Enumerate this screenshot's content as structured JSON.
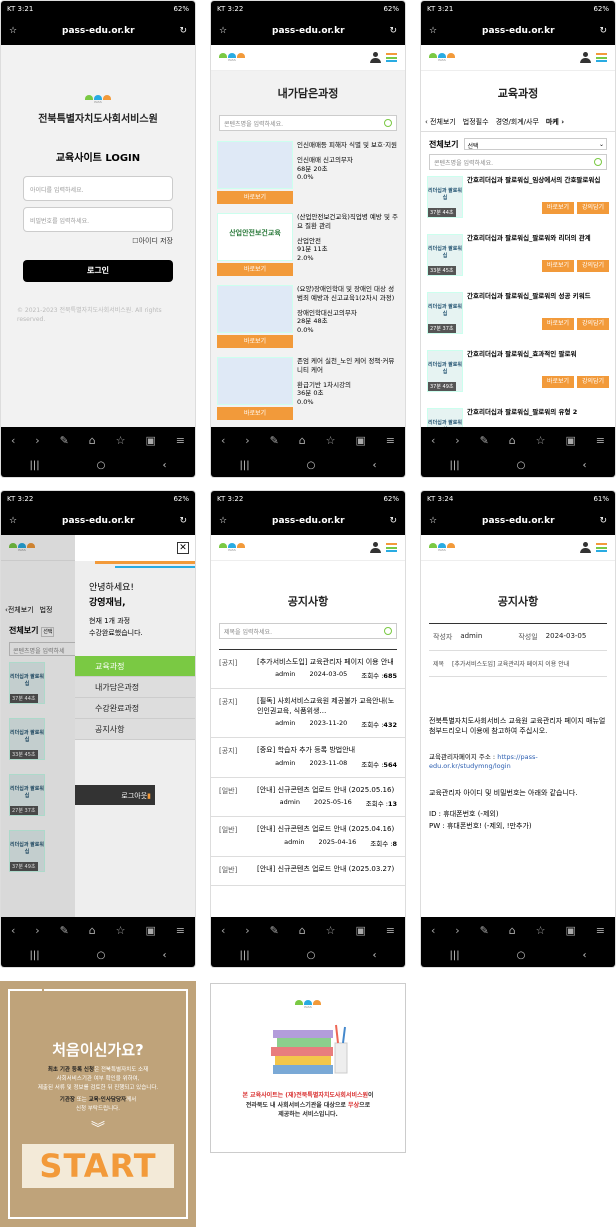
{
  "status": {
    "carrier1": "KT 3:21",
    "carrier2": "KT 3:22",
    "carrier3": "KT 3:21",
    "carrier4": "KT 3:22",
    "carrier5": "KT 3:22",
    "carrier6": "KT 3:24",
    "bat62": "62%",
    "bat61": "61%"
  },
  "url": "pass-edu.or.kr",
  "logo_small": "PASS",
  "login": {
    "org": "전북특별자치도사회서비스원",
    "title": "교육사이트 LOGIN",
    "id_ph": "아이디를 입력하세요.",
    "pw_ph": "비밀번호를 입력하세요.",
    "save": "아이디 저장",
    "button": "로그인",
    "copy": "© 2021-2023 전북특별자치도사회서비스원. All rights reserved."
  },
  "mycourses": {
    "title": "내가담은과정",
    "search_ph": "콘텐츠명을 입력하세요.",
    "items": [
      {
        "title": "인신매매등 피해자 식별 및 보호·지원",
        "sub": "인신매매 신고의무자",
        "meta": "68분 20초",
        "pct": "0.0%",
        "btn": "바로보기"
      },
      {
        "title": "(산업안전보건교육)직업병 예방 및 주요 질환 관리",
        "sub": "산업안전",
        "meta": "91분 11초",
        "pct": "2.0%",
        "btn": "바로보기",
        "thumb": "산업안전보건교육"
      },
      {
        "title": "(요양)장애인학대 및 장애인 대상 성범죄 예방과 신고교육1(2차시 과정)",
        "sub": "장애인학대신고의무자",
        "meta": "28분 48초",
        "pct": "0.0%",
        "btn": "바로보기"
      },
      {
        "title": "존엄 케어 실천_노인 케어 정책·커뮤니티 케어",
        "sub": "환급기반 1차시강의",
        "meta": "36분 0초",
        "pct": "0.0%",
        "btn": "바로보기"
      }
    ]
  },
  "courses": {
    "title": "교육과정",
    "tabs": [
      "전체보기",
      "법정필수",
      "경영/회계/사무",
      "마케"
    ],
    "filter_label": "전체보기",
    "select": "선택",
    "search_ph": "콘텐츠명을 입력하세요.",
    "items": [
      {
        "title": "간호리더십과 팔로워십_임상에서의 간호팔로워십",
        "time": "37분 44초"
      },
      {
        "title": "간호리더십과 팔로워십_팔로워와 리더의 관계",
        "time": "33분 45초"
      },
      {
        "title": "간호리더십과 팔로워십_팔로워의 성공 키워드",
        "time": "27분 37초"
      },
      {
        "title": "간호리더십과 팔로워십_효과적인 팔로워",
        "time": "37분 49초"
      },
      {
        "title": "간호리더십과 팔로워십_팔로워의 유형 2",
        "time": ""
      }
    ],
    "btn1": "바로보기",
    "btn2": "강의담기",
    "thumb_text": "리더십과 팔로워십"
  },
  "menu": {
    "greeting": "안녕하세요!",
    "user": "강영재님,",
    "info1": "현재 1개 과정",
    "info2": "수강완료했습니다.",
    "items": [
      "교육과정",
      "내가담은과정",
      "수강완료과정",
      "공지사항"
    ],
    "logout": "로그아웃",
    "bg_tabs": [
      "전체보기",
      "법정"
    ],
    "bg_filter": "전체보기",
    "bg_select": "선택",
    "bg_search": "콘텐츠명을 입력하세"
  },
  "notice": {
    "title": "공지사항",
    "search_ph": "제목을 입력하세요.",
    "items": [
      {
        "cat": "[공지]",
        "title": "[추가서비스도입] 교육관리자 페이지 이용 안내",
        "author": "admin",
        "date": "2024-03-05",
        "views_label": "조회수 :",
        "views": "685"
      },
      {
        "cat": "[공지]",
        "title": "[필독] 사회서비스교육원 제공불가 교육안내(노인인권교육, 식품위생…",
        "author": "admin",
        "date": "2023-11-20",
        "views_label": "조회수 :",
        "views": "432"
      },
      {
        "cat": "[공지]",
        "title": "[중요] 학습자 추가 등록 방법안내",
        "author": "admin",
        "date": "2023-11-08",
        "views_label": "조회수 :",
        "views": "564"
      },
      {
        "cat": "[일반]",
        "title": "[안내] 신규콘텐츠 업로드 안내 (2025.05.16)",
        "author": "admin",
        "date": "2025-05-16",
        "views_label": "조회수 :",
        "views": "13"
      },
      {
        "cat": "[일반]",
        "title": "[안내] 신규콘텐츠 업로드 안내 (2025.04.16)",
        "author": "admin",
        "date": "2025-04-16",
        "views_label": "조회수 :",
        "views": "8"
      },
      {
        "cat": "[일반]",
        "title": "[안내] 신규콘텐츠 업로드 안내 (2025.03.27)",
        "author": "",
        "date": "",
        "views_label": "",
        "views": ""
      }
    ]
  },
  "detail": {
    "title": "공지사항",
    "author_label": "작성자",
    "author": "admin",
    "date_label": "작성일",
    "date": "2024-03-05",
    "subj_label": "제목",
    "subj": "[추가서비스도입] 교육관리자 페이지 이용 안내",
    "body1": "전북특별자치도사회서비스 교육원 교육관리자 페이지 매뉴얼 첨부드리오니 이용에 참고하여 주십시오.",
    "body2a": "교육관리자페이지 주소 : ",
    "body2b": "https://pass-edu.or.kr/studymng/login",
    "body3": "교육관리자 아이디 및 비밀번호는 아래와 같습니다.",
    "body4": "ID : 휴대폰번호 (-제외)",
    "body5": "PW : 휴대폰번호! (-제외, !만추가)"
  },
  "banner1": {
    "title": "처음이신가요?",
    "l1a": "최초 기관 등록 신청",
    "l1b": "은 전북특별자치도 소재",
    "l2": "사회서비스기관 여부 확인을 위하여,",
    "l3": "제출된 서류 및 정보를 검토한 뒤 진행되고 있습니다.",
    "l4a": "기관장",
    "l4b": " 또는 ",
    "l4c": "교육·인사담당자",
    "l4d": "께서",
    "l5": "신청 부탁드립니다.",
    "start": "START"
  },
  "banner2": {
    "l1a": "본 교육사이트는 (재)전북특별자치도사회서비스원",
    "l1b": "이",
    "l2a": "전라북도 내 사회서비스기관을 대상으로 ",
    "l2b": "무상",
    "l2c": "으로",
    "l3": "제공하는 서비스입니다."
  },
  "colors": {
    "green": "#7ac943",
    "orange": "#f29a3a",
    "blue": "#29abe2",
    "tan": "#bfa37a"
  }
}
